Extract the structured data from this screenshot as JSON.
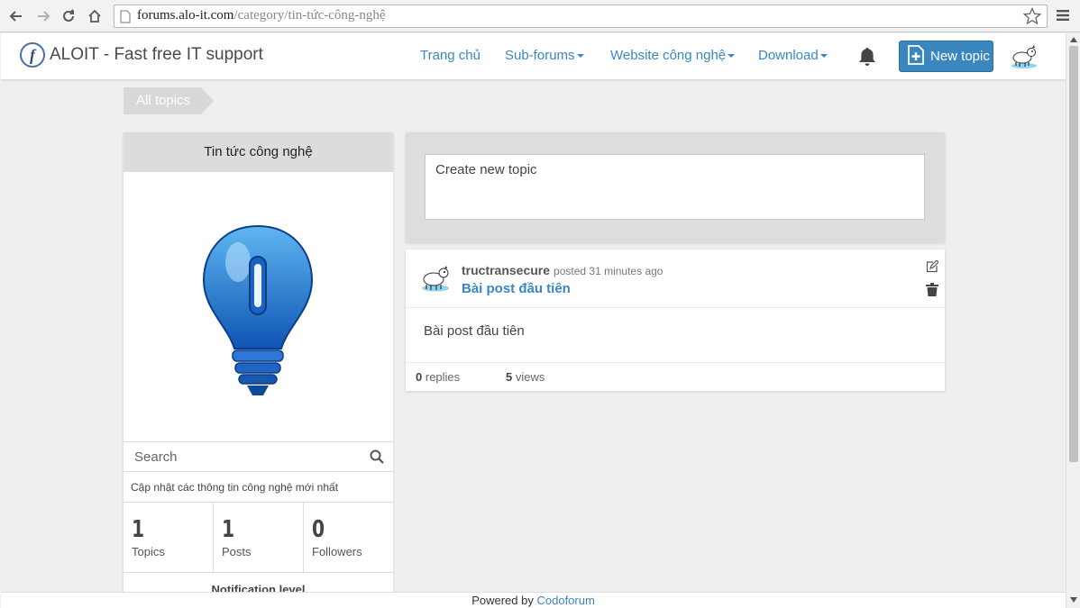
{
  "browser": {
    "url_host": "forums.alo-it.com",
    "url_path": "/category/tin-tức-công-nghệ",
    "icons": [
      "back-icon",
      "forward-icon",
      "reload-icon",
      "home-icon",
      "page-icon",
      "star-icon",
      "menu-icon"
    ]
  },
  "header": {
    "brand_name": "ALOIT - Fast free IT support",
    "logo_letter": "f",
    "nav": [
      {
        "label": "Trang chủ",
        "dropdown": false
      },
      {
        "label": "Sub-forums",
        "dropdown": true
      },
      {
        "label": "Website công nghệ",
        "dropdown": true
      },
      {
        "label": "Download",
        "dropdown": true
      }
    ],
    "new_topic_label": "New topic",
    "accent_color": "#3a87c0"
  },
  "breadcrumb": {
    "label": "All topics"
  },
  "sidebar": {
    "category_title": "Tin tức công nghệ",
    "image_icon": "lightbulb-icon",
    "search_placeholder": "Search",
    "description": "Cập nhật các thông tin công nghệ mới nhất",
    "stats": [
      {
        "value": "1",
        "label": "Topics"
      },
      {
        "value": "1",
        "label": "Posts"
      },
      {
        "value": "0",
        "label": "Followers"
      }
    ],
    "notification_label": "Notification level"
  },
  "create_topic": {
    "placeholder": "Create new topic"
  },
  "post": {
    "author": "tructransecure",
    "meta": "posted 31 minutes ago",
    "title": "Bài post đầu tiên",
    "body": "Bài post đầu tiên",
    "replies_count": "0",
    "replies_label": "replies",
    "views_count": "5",
    "views_label": "views"
  },
  "footer": {
    "prefix": "Powered by",
    "link": "Codoforum"
  }
}
